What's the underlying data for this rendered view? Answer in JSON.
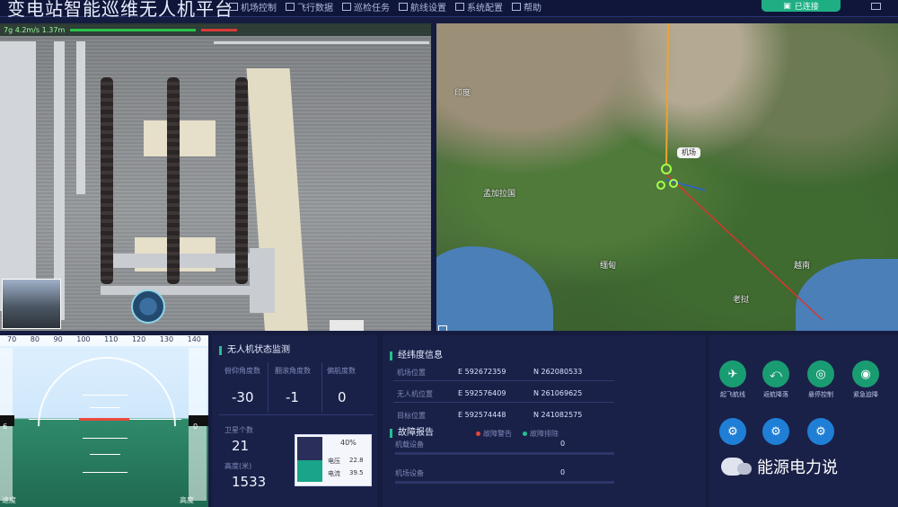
{
  "header": {
    "title": "变电站智能巡维无人机平台",
    "nav": [
      "机场控制",
      "飞行数据",
      "巡检任务",
      "航线设置",
      "系统配置",
      "帮助"
    ],
    "connect_label": "已连接"
  },
  "camera": {
    "status_text": "7g 4.2m/s  1.37m"
  },
  "map": {
    "places": [
      "孟加拉国",
      "缅甸",
      "老挝",
      "越南",
      "印度"
    ],
    "marker_label": "机场"
  },
  "attitude": {
    "top_ticks": [
      "70",
      "80",
      "90",
      "100",
      "110",
      "120",
      "130",
      "140"
    ],
    "left_box": "6",
    "right_box": "0",
    "bottom_left": "速度",
    "bottom_right": "高度"
  },
  "status": {
    "title": "无人机状态监测",
    "pitch_label": "俯仰角度数",
    "pitch_value": "-30",
    "roll_label": "翻滚角度数",
    "roll_value": "-1",
    "heading_label": "偏航度数",
    "heading_value": "0",
    "sat_label": "卫星个数",
    "sat_value": "21",
    "height_label": "高度(米)",
    "height_value": "1533",
    "battery_percent": "40%",
    "battery_label_a": "电压",
    "battery_value_a": "22.8",
    "battery_label_b": "电流",
    "battery_value_b": "39.5"
  },
  "coords": {
    "title": "经纬度信息",
    "rows": [
      {
        "label": "机场位置",
        "lon": "E 592672359",
        "lat": "N 262080533"
      },
      {
        "label": "无人机位置",
        "lon": "E 592576409",
        "lat": "N 261069625"
      },
      {
        "label": "目标位置",
        "lon": "E 592574448",
        "lat": "N 241082575"
      }
    ],
    "faults_title": "故障报告",
    "legend_a": "故障警告",
    "legend_b": "故障排除",
    "fault_rows": [
      {
        "label": "机载设备",
        "value": "0"
      },
      {
        "label": "机场设备",
        "value": "0"
      }
    ],
    "legend_a_color": "#e2473c",
    "legend_b_color": "#24c08e"
  },
  "actions": {
    "items": [
      {
        "label": "起飞航线",
        "style": "green",
        "icon": "drone-icon"
      },
      {
        "label": "返航降落",
        "style": "green",
        "icon": "drone-return-icon"
      },
      {
        "label": "悬停控制",
        "style": "green",
        "icon": "hover-icon"
      },
      {
        "label": "紧急迫降",
        "style": "green",
        "icon": "emergency-icon"
      },
      {
        "label": "",
        "style": "blue",
        "icon": "camera-icon"
      },
      {
        "label": "",
        "style": "blue",
        "icon": "gimbal-icon"
      },
      {
        "label": "",
        "style": "blue",
        "icon": "zoom-icon"
      }
    ]
  },
  "watermark": {
    "text": "能源电力说"
  }
}
